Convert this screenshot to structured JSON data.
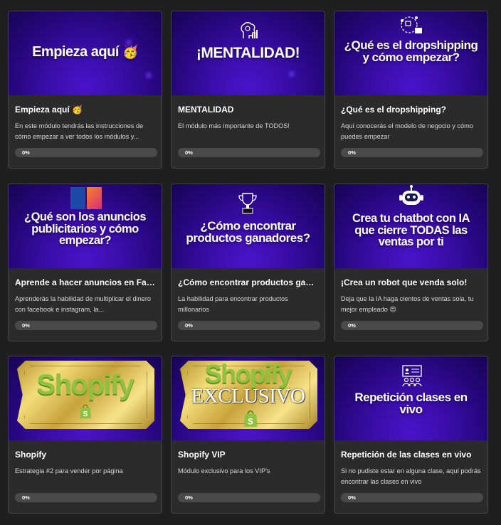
{
  "colors": {
    "page_bg": "#1f1f1f",
    "card_bg": "#2b2b2b",
    "banner_purple": "#3a0da8",
    "progress_track": "#4a4a4a",
    "shopify_green": "#8fc33f",
    "gold": "#e6c65c"
  },
  "cards": [
    {
      "banner_text": "Empieza aquí",
      "banner_emoji": "🥳",
      "title": "Empieza aquí 🥳",
      "description": "En este módulo tendrás las instrucciones de cómo empezar a ver todos los módulos y...",
      "progress": "0%",
      "progress_value": 0,
      "icon": "party-face-icon"
    },
    {
      "banner_text": "¡MENTALIDAD!",
      "title": "MENTALIDAD",
      "description": "El módulo más importante de TODOS!",
      "progress": "0%",
      "progress_value": 0,
      "icon": "brain-growth-icon"
    },
    {
      "banner_text_line1": "¿Qué es el dropshipping",
      "banner_text_line2": "y cómo empezar?",
      "title": "¿Qué es el dropshipping?",
      "description": "Aquí conocerás el modelo de negocio y cómo puedes empezar",
      "progress": "0%",
      "progress_value": 0,
      "icon": "delivery-network-icon"
    },
    {
      "banner_text_line1": "¿Qué son los anuncios",
      "banner_text_line2": "publicitarios y cómo",
      "banner_text_line3": "empezar?",
      "title": "Aprende a hacer anuncios en Facebook",
      "description": "Aprenderás la habilidad de multiplicar el dinero con facebook e instagram, la...",
      "progress": "0%",
      "progress_value": 0,
      "icon": "social-ads-icon"
    },
    {
      "banner_text_line1": "¿Cómo encontrar",
      "banner_text_line2": "productos ganadores?",
      "title": "¿Cómo encontrar productos ganadores?",
      "description": "La habilidad para encontrar productos millonarios",
      "progress": "0%",
      "progress_value": 0,
      "icon": "trophy-icon"
    },
    {
      "banner_text_line1": "Crea tu chatbot con IA",
      "banner_text_line2": "que cierre TODAS las",
      "banner_text_line3": "ventas por ti",
      "title": "¡Crea un robot que venda solo!",
      "description": "Deja que la IA haga cientos de ventas sola, tu mejor empleado 😍",
      "progress": "0%",
      "progress_value": 0,
      "icon": "robot-icon"
    },
    {
      "banner_text": "Shopify",
      "title": "Shopify",
      "description": "Estrategia #2 para vender por página",
      "progress": "0%",
      "progress_value": 0,
      "icon": "shopify-bag-icon"
    },
    {
      "banner_text": "Shopify",
      "banner_subtext": "EXCLUSIVO",
      "title": "Shopify VIP",
      "description": "Módulo exclusivo para los VIP's",
      "progress": "0%",
      "progress_value": 0,
      "icon": "shopify-bag-icon"
    },
    {
      "banner_text_line1": "Repetición clases en",
      "banner_text_line2": "vivo",
      "title": "Repetición de las clases en vivo",
      "description": "Si no pudiste estar en alguna clase, aquí podrás encontrar las clases en vivo",
      "progress": "0%",
      "progress_value": 0,
      "icon": "online-class-icon"
    }
  ]
}
